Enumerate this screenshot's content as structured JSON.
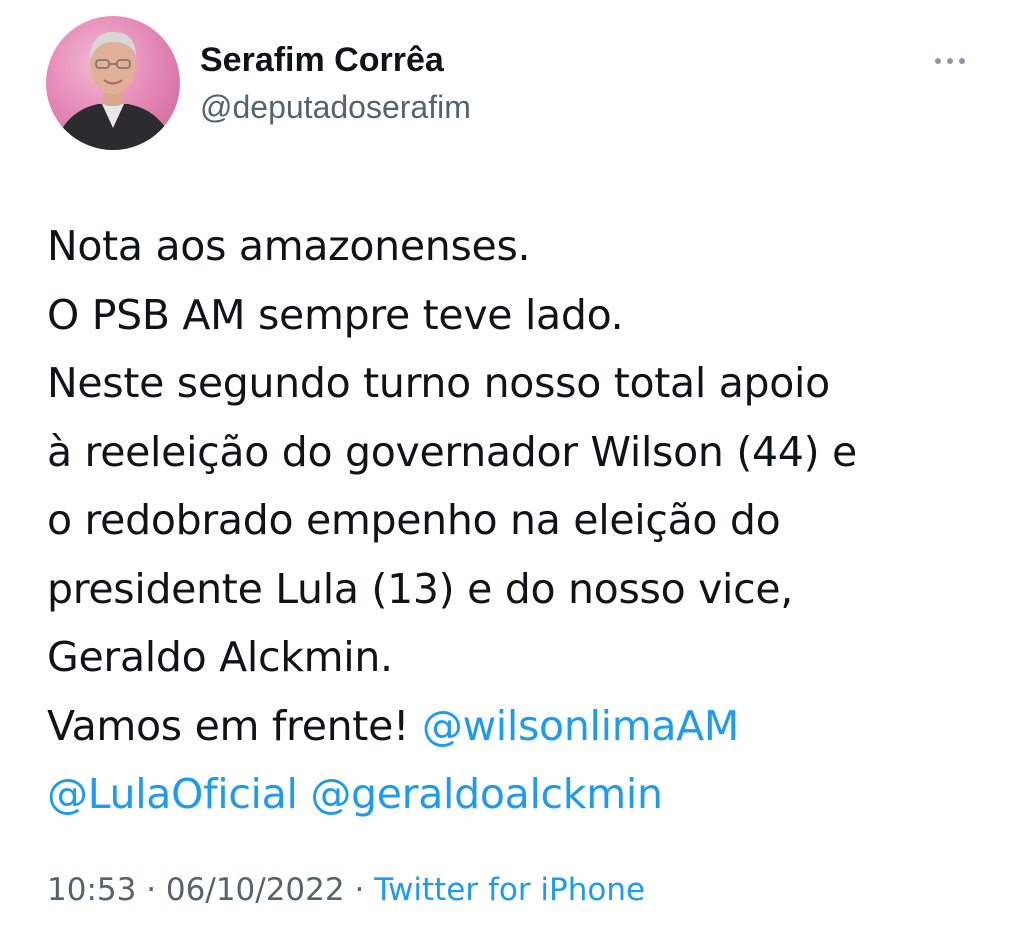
{
  "author": {
    "name": "Serafim Corrêa",
    "handle": "@deputadoserafim"
  },
  "tweet": {
    "lines": [
      "Nota aos amazonenses.",
      "O PSB AM sempre teve lado.",
      "Neste segundo turno nosso total apoio",
      "à reeleição do governador Wilson (44) e",
      "o redobrado empenho na eleição do",
      "presidente Lula (13) e do nosso vice,",
      "Geraldo Alckmin."
    ],
    "closing": "Vamos em frente!",
    "mentions": [
      "@wilsonlimaAM",
      "@LulaOficial",
      "@geraldoalckmin"
    ]
  },
  "meta": {
    "time": "10:53",
    "separator": "·",
    "date": "06/10/2022",
    "source": "Twitter for iPhone"
  },
  "colors": {
    "accent": "#1d9bf0",
    "text": "#0f1419",
    "muted": "#536471"
  },
  "icons": {
    "more": "more-horizontal-icon"
  }
}
